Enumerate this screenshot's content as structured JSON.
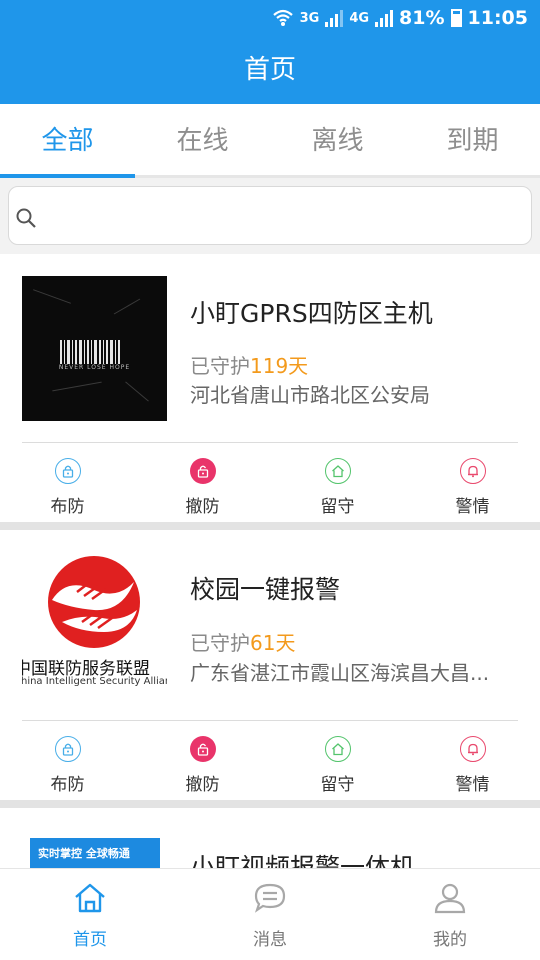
{
  "status_bar": {
    "network1": "3G",
    "network2": "4G",
    "battery": "81%",
    "time": "11:05"
  },
  "header": {
    "title": "首页"
  },
  "tabs": [
    {
      "label": "全部",
      "active": true
    },
    {
      "label": "在线",
      "active": false
    },
    {
      "label": "离线",
      "active": false
    },
    {
      "label": "到期",
      "active": false
    }
  ],
  "search": {
    "placeholder": "",
    "value": ""
  },
  "devices": [
    {
      "name": "小盯GPRS四防区主机",
      "guard_prefix": "已守护",
      "guard_days": "119天",
      "address": "河北省唐山市路北区公安局",
      "thumbnail": {
        "type": "photo-dark",
        "caption": "NEVER LOSE HOPE"
      },
      "actions": [
        {
          "label": "布防",
          "icon": "lock-icon"
        },
        {
          "label": "撤防",
          "icon": "unlock-icon"
        },
        {
          "label": "留守",
          "icon": "home-icon"
        },
        {
          "label": "警情",
          "icon": "bell-icon"
        }
      ]
    },
    {
      "name": "校园一键报警",
      "guard_prefix": "已守护",
      "guard_days": "61天",
      "address": "广东省湛江市霞山区海滨昌大昌...",
      "thumbnail": {
        "type": "logo",
        "caption": "中国联防服务联盟",
        "caption_en": "China Intelligent Security Alliance"
      },
      "actions": [
        {
          "label": "布防",
          "icon": "lock-icon"
        },
        {
          "label": "撤防",
          "icon": "unlock-icon"
        },
        {
          "label": "留守",
          "icon": "home-icon"
        },
        {
          "label": "警情",
          "icon": "bell-icon"
        }
      ]
    },
    {
      "name": "小盯视频报警一体机",
      "thumbnail": {
        "type": "promo",
        "caption": "实时掌控 全球畅通"
      }
    }
  ],
  "bottom_nav": [
    {
      "label": "首页",
      "icon": "home-icon",
      "active": true
    },
    {
      "label": "消息",
      "icon": "chat-icon",
      "active": false
    },
    {
      "label": "我的",
      "icon": "user-icon",
      "active": false
    }
  ],
  "colors": {
    "primary": "#1f96ea",
    "accent_orange": "#f39a1c",
    "disarm_pink": "#e9346a",
    "stay_green": "#53c46c",
    "alarm_red": "#e9496d"
  }
}
